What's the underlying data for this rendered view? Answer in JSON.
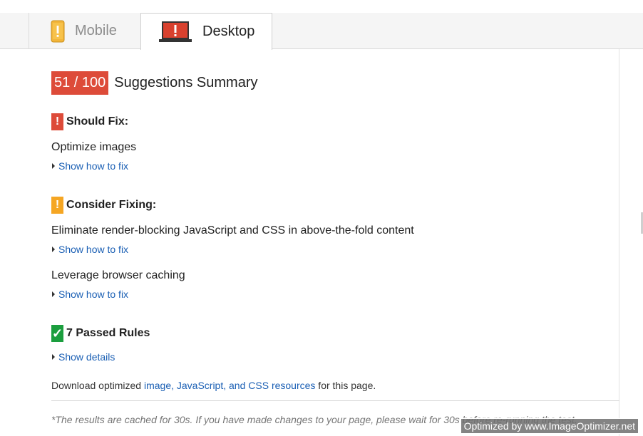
{
  "tabs": {
    "mobile": {
      "label": "Mobile",
      "icon": "phone-warning-icon",
      "active": false
    },
    "desktop": {
      "label": "Desktop",
      "icon": "laptop-warning-icon",
      "active": true
    }
  },
  "summary": {
    "score": "51 / 100",
    "title": "Suggestions Summary",
    "score_color": "#dd4b39"
  },
  "sections": {
    "should_fix": {
      "mark": "!",
      "title": "Should Fix:",
      "color": "#dd4b39",
      "rules": [
        {
          "title": "Optimize images",
          "link": "Show how to fix"
        }
      ]
    },
    "consider_fixing": {
      "mark": "!",
      "title": "Consider Fixing:",
      "color": "#f5a623",
      "rules": [
        {
          "title": "Eliminate render-blocking JavaScript and CSS in above-the-fold content",
          "link": "Show how to fix"
        },
        {
          "title": "Leverage browser caching",
          "link": "Show how to fix"
        }
      ]
    },
    "passed": {
      "mark": "✓",
      "title": "7 Passed Rules",
      "color": "#1b9e3e",
      "link": "Show details"
    }
  },
  "download": {
    "prefix": "Download optimized ",
    "link": "image, JavaScript, and CSS resources",
    "suffix": " for this page."
  },
  "cache_note": "*The results are cached for 30s. If you have made changes to your page, please wait for 30s before re-running the test.",
  "watermark": "Optimized by www.ImageOptimizer.net"
}
